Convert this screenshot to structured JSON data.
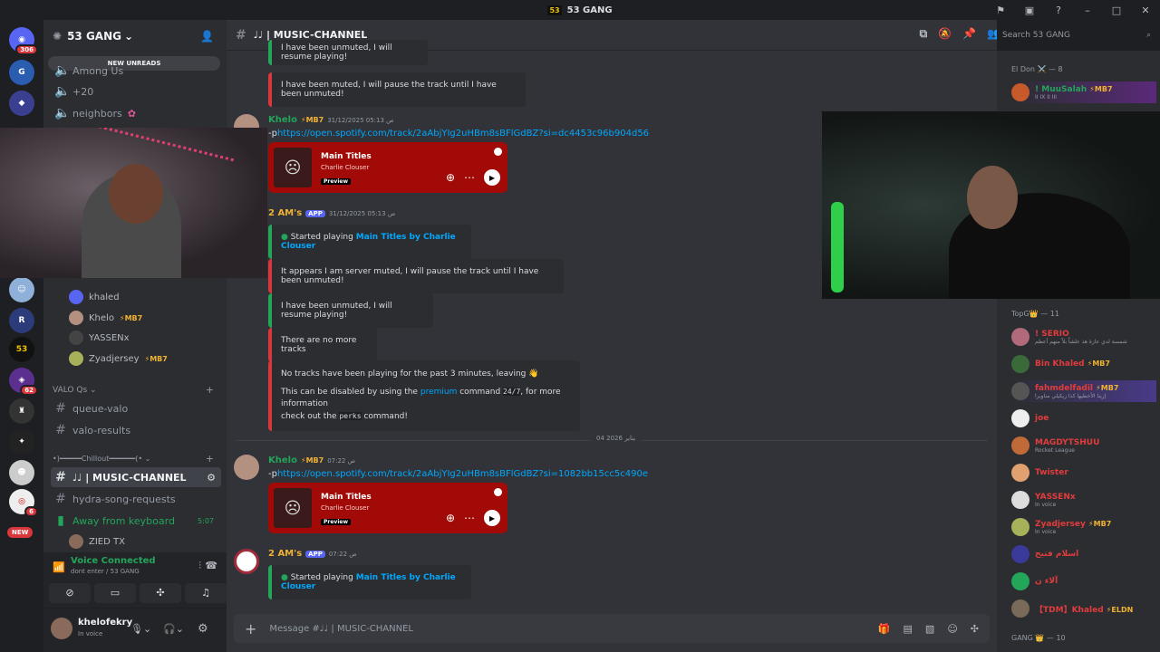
{
  "window": {
    "title": "53 GANG",
    "server_badge": "53"
  },
  "guilds": {
    "home_badge": "306",
    "g1_badge": "62",
    "g2_badge": "6",
    "new_label": "NEW"
  },
  "server": {
    "name": "53 GANG",
    "new_unreads": "NEW UNREADS"
  },
  "channels": {
    "among": "Among Us",
    "c20": "+20",
    "neighbors": "neighbors",
    "voice_users": [
      {
        "name": "khaled",
        "badge": ""
      },
      {
        "name": "Khelo",
        "badge": "MB7"
      },
      {
        "name": "YASSENx",
        "badge": ""
      },
      {
        "name": "Zyadjersey",
        "badge": "MB7"
      }
    ],
    "valo_cat": "VALO Qs",
    "queue_valo": "queue-valo",
    "valo_results": "valo-results",
    "chillout_cat": "•)━━━━━Chillout━━━━━━(•",
    "music": "♩♩ | MUSIC-CHANNEL",
    "hydra": "hydra-song-requests",
    "afk": "Away from keyboard",
    "afk_time": "5:07",
    "afk_user": "ZIED TX"
  },
  "voice": {
    "status": "Voice Connected",
    "where": "dont enter / 53 GANG"
  },
  "user": {
    "name": "khelofekry",
    "status": "In voice"
  },
  "header": {
    "channel": "♩♩ | MUSIC-CHANNEL",
    "search_placeholder": "Search 53 GANG"
  },
  "messages": {
    "m_top": "I have been unmuted, I will resume playing!",
    "m_muted": "I have been muted, I will pause the track until I have been unmuted!",
    "k1_name": "Khelo",
    "k1_badge": "MB7",
    "k1_time": "31/12/2025 05:13 ص",
    "k1_prefix": "-p",
    "k1_link": "https://open.spotify.com/track/2aAbjYIg2uHBm8sBFlGdBZ?si=dc4453c96b904d56",
    "track_title": "Main Titles",
    "track_artist": "Charlie Clouser",
    "preview": "Preview",
    "b1_name": "2 AM's",
    "app_tag": "APP",
    "b1_time": "31/12/2025 05:13 ص",
    "started": "Started playing",
    "started_link": "Main Titles by Charlie Clouser",
    "server_muted": "It appears I am server muted, I will pause the track until I have been unmuted!",
    "unmuted": "I have been unmuted, I will resume playing!",
    "no_more": "There are no more tracks",
    "no_tracks_1": "No tracks have been playing for the past 3 minutes, leaving 👋",
    "no_tracks_2a": "This can be disabled by using the",
    "premium": "premium",
    "no_tracks_2b": "command",
    "cmd_247": "24/7",
    "no_tracks_2c": ", for more information",
    "no_tracks_3a": "check out the",
    "cmd_perks": "perks",
    "no_tracks_3b": "command!",
    "date_divider": "04 يناير 2026",
    "k2_time": "07:22 ص",
    "k2_link": "https://open.spotify.com/track/2aAbjYIg2uHBm8sBFlGdBZ?si=1082bb15cc5c490e",
    "b2_time": "07:22 ص"
  },
  "composer": {
    "placeholder": "Message #♩♩ | MUSIC-CHANNEL"
  },
  "members": {
    "g1": "El Don ⚔️ — 8",
    "m1": {
      "name": "! MuuSalah",
      "sub": "II IX II III",
      "badge": "MB7"
    },
    "g2": "TopG👑 — 11",
    "list": [
      {
        "name": "! SERIO",
        "sub": "شمسة لدي عازة هذ علشاً بلاً منهم أعظم",
        "badge": "",
        "color": "#e23c3c"
      },
      {
        "name": "Bin Khaled",
        "sub": "",
        "badge": "MB7",
        "color": "#e23c3c"
      },
      {
        "name": "fahmdelfadil",
        "sub": "إزينا الأخطيها كذا زيكيلي مناويرا",
        "badge": "MB7",
        "color": "#e23c3c"
      },
      {
        "name": "joe",
        "sub": "",
        "badge": "",
        "color": "#e23c3c"
      },
      {
        "name": "MAGDYTSHUU",
        "sub": "Rocket League",
        "badge": "",
        "color": "#e23c3c"
      },
      {
        "name": "Twister",
        "sub": "",
        "badge": "",
        "color": "#e23c3c"
      },
      {
        "name": "YASSENx",
        "sub": "In voice",
        "badge": "",
        "color": "#e23c3c"
      },
      {
        "name": "Zyadjersey",
        "sub": "In voice",
        "badge": "MB7",
        "color": "#e23c3c"
      },
      {
        "name": "اسلام فتيح",
        "sub": "",
        "badge": "",
        "color": "#e23c3c"
      },
      {
        "name": "آلاء ن",
        "sub": "",
        "badge": "",
        "color": "#e23c3c"
      },
      {
        "name": "【TDM】Khaled",
        "sub": "",
        "badge": "ELDN",
        "color": "#e23c3c"
      }
    ],
    "g3": "GANG 👑 — 10"
  }
}
